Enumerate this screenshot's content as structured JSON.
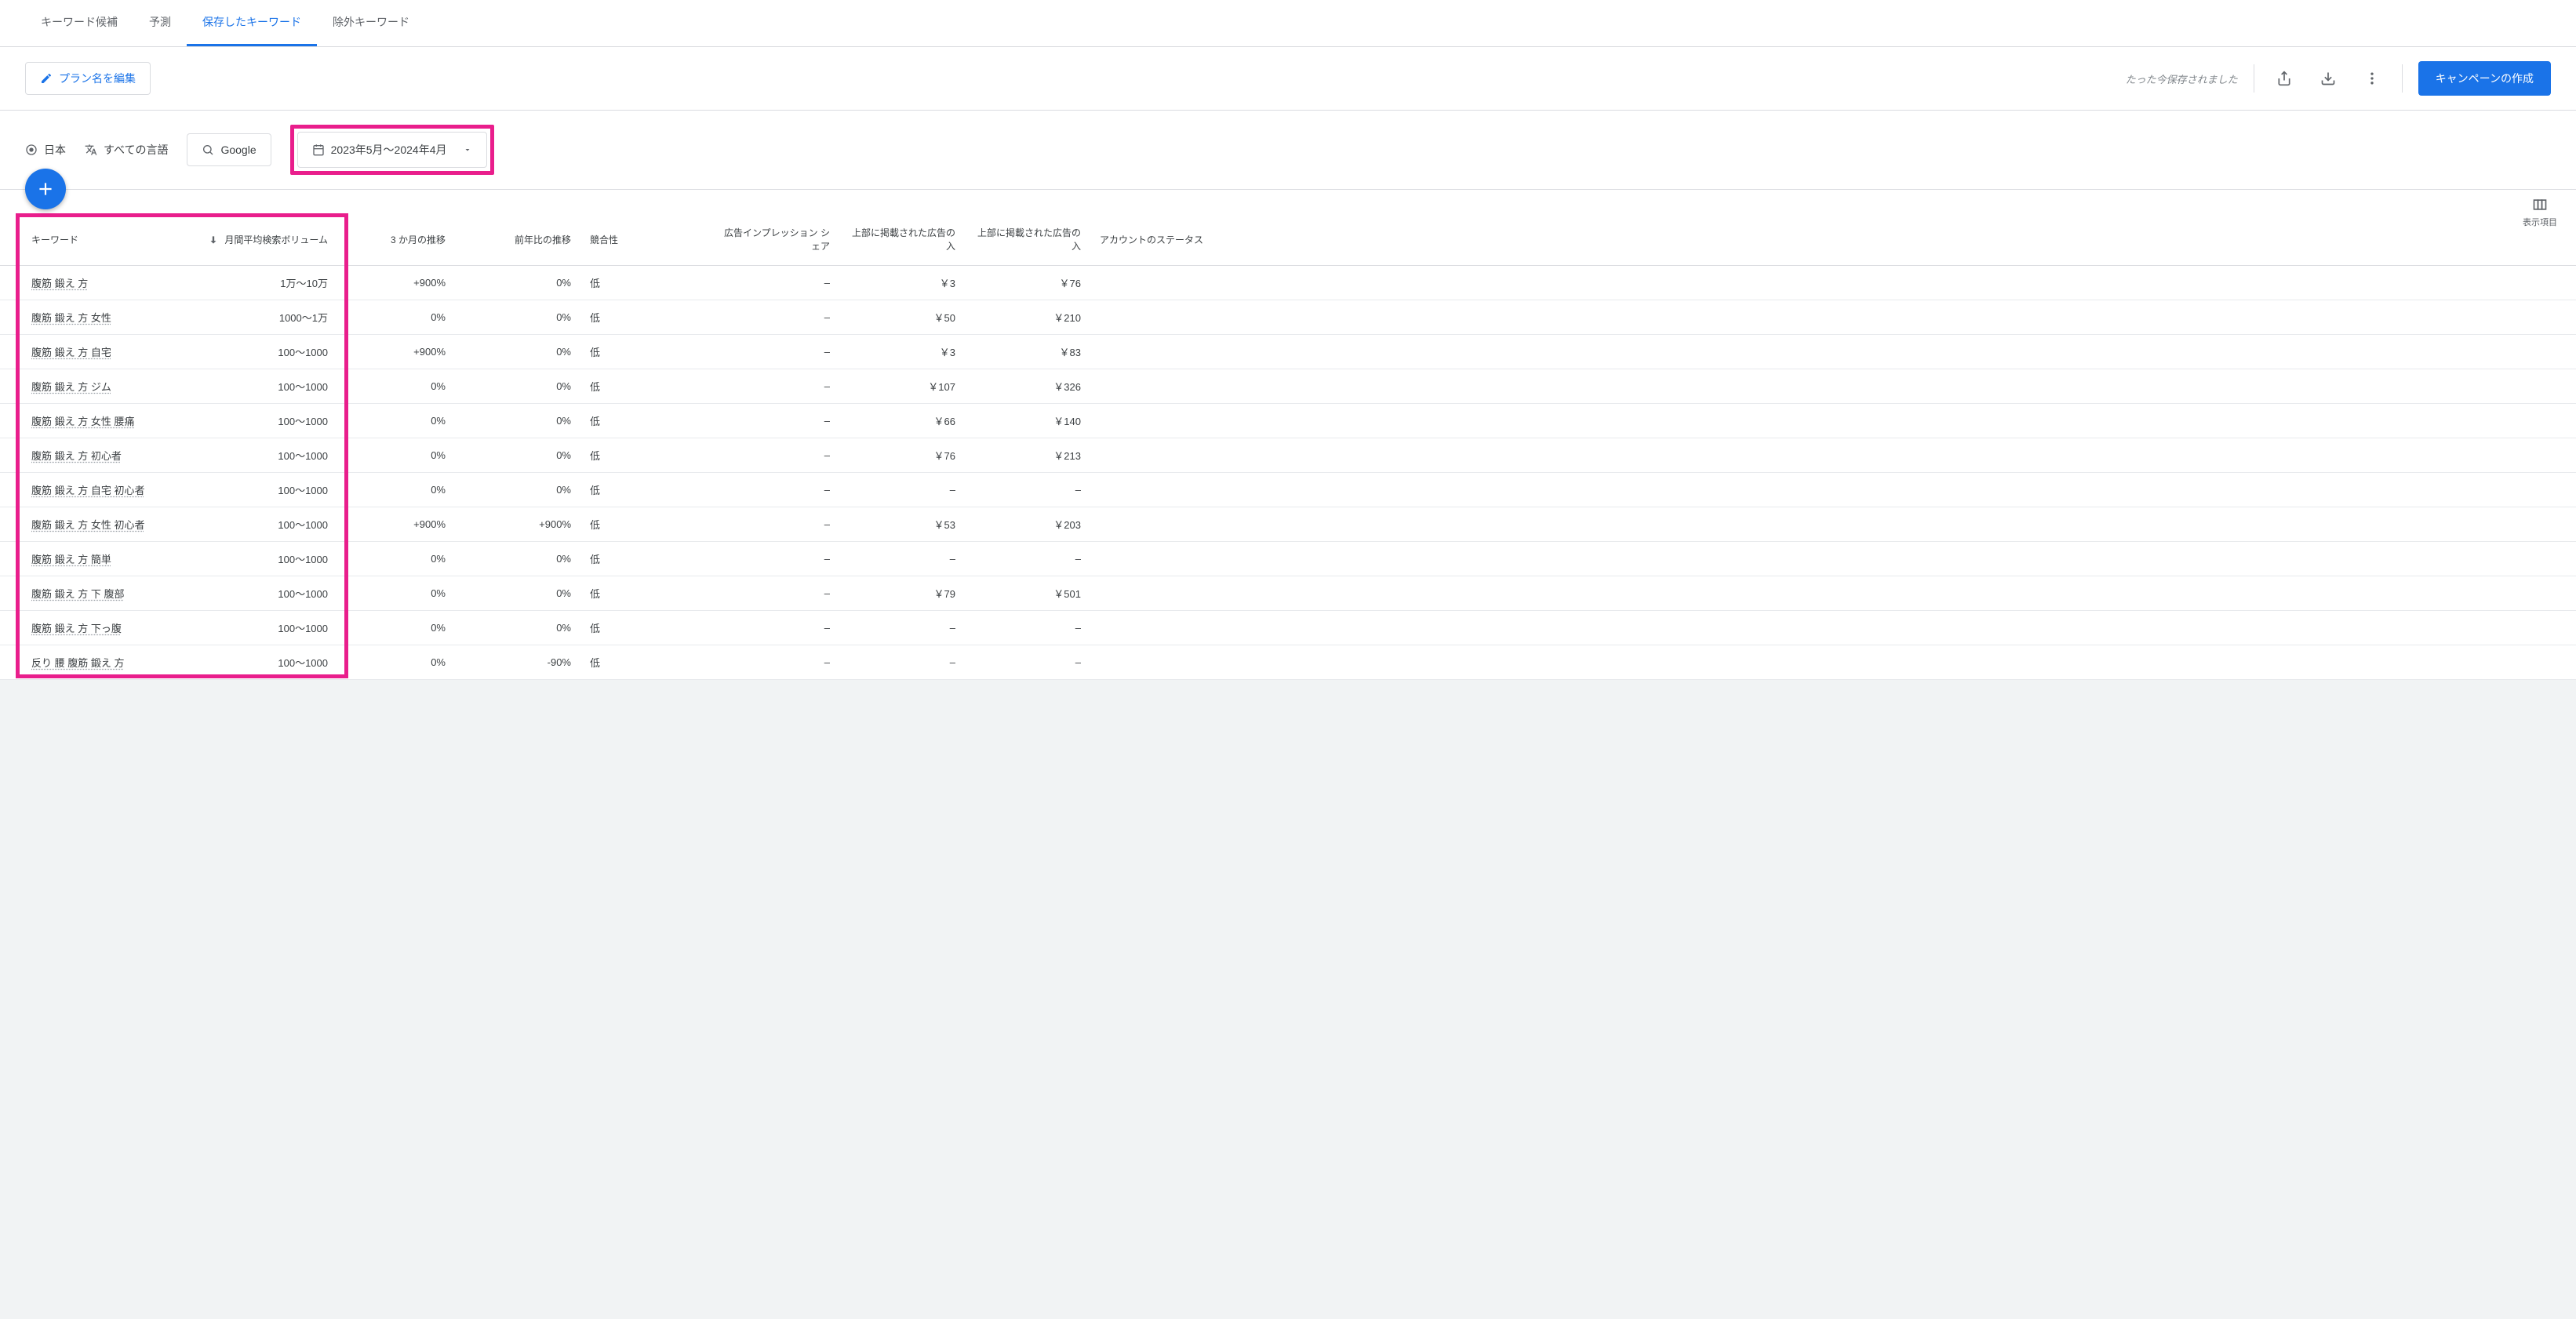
{
  "tabs": {
    "suggestions": "キーワード候補",
    "forecast": "予測",
    "saved": "保存したキーワード",
    "negative": "除外キーワード"
  },
  "toolbar": {
    "edit_plan": "プラン名を編集",
    "saved_msg": "たった今保存されました",
    "create_campaign": "キャンペーンの作成"
  },
  "filters": {
    "location": "日本",
    "language": "すべての言語",
    "network": "Google",
    "date_range": "2023年5月～2024年4月"
  },
  "columns_label": "表示項目",
  "table": {
    "headers": {
      "keyword": "キーワード",
      "volume": "月間平均検索ボリューム",
      "three_month": "3 か月の推移",
      "yoy": "前年比の推移",
      "competition": "競合性",
      "impression_share": "広告インプレッション シェア",
      "top_bid_low": "上部に掲載された広告の入",
      "top_bid_high": "上部に掲載された広告の入",
      "account_status": "アカウントのステータス"
    },
    "rows": [
      {
        "kw": "腹筋 鍛え 方",
        "vol": "1万～10万",
        "m3": "+900%",
        "yoy": "0%",
        "comp": "低",
        "imp": "–",
        "bid1": "￥3",
        "bid2": "￥76",
        "status": ""
      },
      {
        "kw": "腹筋 鍛え 方 女性",
        "vol": "1000～1万",
        "m3": "0%",
        "yoy": "0%",
        "comp": "低",
        "imp": "–",
        "bid1": "￥50",
        "bid2": "￥210",
        "status": ""
      },
      {
        "kw": "腹筋 鍛え 方 自宅",
        "vol": "100～1000",
        "m3": "+900%",
        "yoy": "0%",
        "comp": "低",
        "imp": "–",
        "bid1": "￥3",
        "bid2": "￥83",
        "status": ""
      },
      {
        "kw": "腹筋 鍛え 方 ジム",
        "vol": "100～1000",
        "m3": "0%",
        "yoy": "0%",
        "comp": "低",
        "imp": "–",
        "bid1": "￥107",
        "bid2": "￥326",
        "status": ""
      },
      {
        "kw": "腹筋 鍛え 方 女性 腰痛",
        "vol": "100～1000",
        "m3": "0%",
        "yoy": "0%",
        "comp": "低",
        "imp": "–",
        "bid1": "￥66",
        "bid2": "￥140",
        "status": ""
      },
      {
        "kw": "腹筋 鍛え 方 初心者",
        "vol": "100～1000",
        "m3": "0%",
        "yoy": "0%",
        "comp": "低",
        "imp": "–",
        "bid1": "￥76",
        "bid2": "￥213",
        "status": ""
      },
      {
        "kw": "腹筋 鍛え 方 自宅 初心者",
        "vol": "100～1000",
        "m3": "0%",
        "yoy": "0%",
        "comp": "低",
        "imp": "–",
        "bid1": "–",
        "bid2": "–",
        "status": ""
      },
      {
        "kw": "腹筋 鍛え 方 女性 初心者",
        "vol": "100～1000",
        "m3": "+900%",
        "yoy": "+900%",
        "comp": "低",
        "imp": "–",
        "bid1": "￥53",
        "bid2": "￥203",
        "status": ""
      },
      {
        "kw": "腹筋 鍛え 方 簡単",
        "vol": "100～1000",
        "m3": "0%",
        "yoy": "0%",
        "comp": "低",
        "imp": "–",
        "bid1": "–",
        "bid2": "–",
        "status": ""
      },
      {
        "kw": "腹筋 鍛え 方 下 腹部",
        "vol": "100～1000",
        "m3": "0%",
        "yoy": "0%",
        "comp": "低",
        "imp": "–",
        "bid1": "￥79",
        "bid2": "￥501",
        "status": ""
      },
      {
        "kw": "腹筋 鍛え 方 下っ腹",
        "vol": "100～1000",
        "m3": "0%",
        "yoy": "0%",
        "comp": "低",
        "imp": "–",
        "bid1": "–",
        "bid2": "–",
        "status": ""
      },
      {
        "kw": "反り 腰 腹筋 鍛え 方",
        "vol": "100～1000",
        "m3": "0%",
        "yoy": "-90%",
        "comp": "低",
        "imp": "–",
        "bid1": "–",
        "bid2": "–",
        "status": ""
      }
    ]
  }
}
